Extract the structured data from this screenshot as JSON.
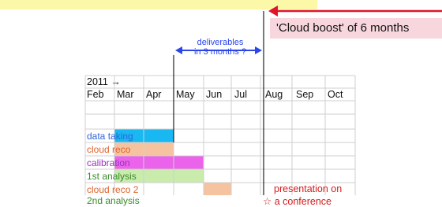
{
  "year_label": "2011 →",
  "months": [
    "Feb",
    "Mar",
    "Apr",
    "May",
    "Jun",
    "Jul",
    "Aug",
    "Sep",
    "Oct"
  ],
  "rows": [
    {
      "label": "data taking",
      "color": "#2f63d9"
    },
    {
      "label": "cloud reco",
      "color": "#e0622b"
    },
    {
      "label": "calibration",
      "color": "#9c2fc3"
    },
    {
      "label": "1st analysis",
      "color": "#3a8a2f"
    },
    {
      "label": "cloud reco 2",
      "color": "#e0622b"
    },
    {
      "label": "2nd analysis",
      "color": "#3a8a2f"
    }
  ],
  "boost_label": "'Cloud boost' of 6 months",
  "deliverables_line1": "deliverables",
  "deliverables_line2": "in 3 months ?",
  "presentation_line1": "presentation on",
  "presentation_line2": "a conference",
  "star_icon": "☆",
  "colors": {
    "data_taking_bar": "#19b8f2",
    "cloud_reco_bar": "#f6c3a0",
    "calibration_bar": "#ea63ea",
    "analysis_bar": "#c9ecac",
    "boost_arrow": "#e0142a",
    "deliverables_arrow": "#2a45ea",
    "highlight_band": "#fbf8a8",
    "boost_box": "#f7d7dd"
  }
}
